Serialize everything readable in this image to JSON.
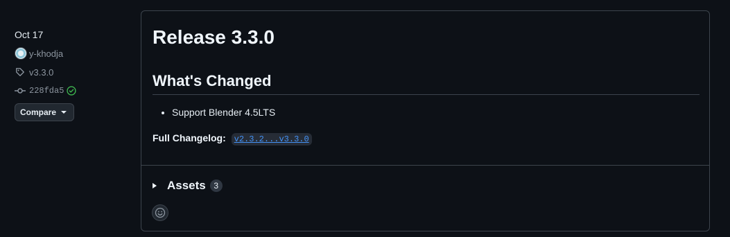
{
  "sidebar": {
    "date": "Oct 17",
    "author": "y-khodja",
    "tag": "v3.3.0",
    "commit": "228fda5",
    "compare_label": "Compare"
  },
  "release": {
    "title": "Release 3.3.0",
    "changes_heading": "What's Changed",
    "changes": [
      "Support Blender 4.5LTS"
    ],
    "changelog_label": "Full Changelog:",
    "changelog_link": "v2.3.2...v3.3.0"
  },
  "assets": {
    "label": "Assets",
    "count": "3"
  },
  "icons": {
    "tag": "tag-icon",
    "commit": "git-commit-icon",
    "verified": "check-circle-icon",
    "reaction": "smiley-icon",
    "expand": "triangle-right-icon",
    "dropdown": "caret-down-icon"
  },
  "colors": {
    "background": "#0d1117",
    "border": "#3d444d",
    "muted_text": "#8d96a0",
    "link": "#4493f8",
    "verified": "#3fb950"
  }
}
